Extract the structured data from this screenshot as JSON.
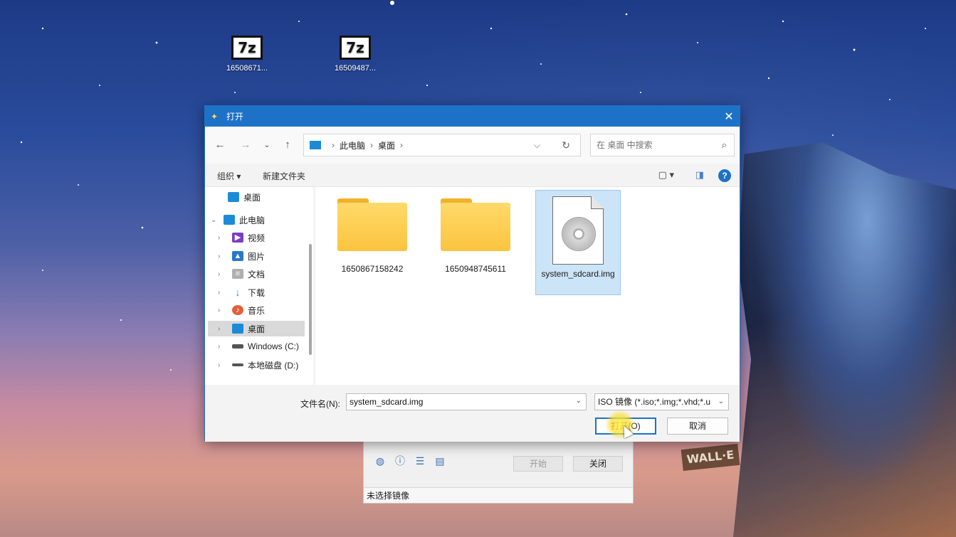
{
  "desktop": {
    "icons": [
      {
        "tile": "7z",
        "label": "16508671..."
      },
      {
        "tile": "7z",
        "label": "16509487..."
      }
    ],
    "wallpaper_badge": "WALL·E"
  },
  "background_app": {
    "start_label": "开始",
    "close_label": "关闭",
    "status": "未选择镜像"
  },
  "dialog": {
    "title": "打开",
    "breadcrumb": [
      "此电脑",
      "桌面"
    ],
    "search_placeholder": "在 桌面 中搜索",
    "toolbar": {
      "organize": "组织 ▾",
      "new_folder": "新建文件夹"
    },
    "sidebar": [
      {
        "label": "桌面",
        "icon": "desktop-icon",
        "color": "#1b8bd6"
      },
      {
        "label": "此电脑",
        "icon": "computer-icon",
        "color": "#1b8bd6"
      },
      {
        "label": "视频",
        "icon": "video-icon",
        "color": "#7a3fbf"
      },
      {
        "label": "图片",
        "icon": "image-icon",
        "color": "#2a78c6"
      },
      {
        "label": "文档",
        "icon": "document-icon",
        "color": "#8a8a8a"
      },
      {
        "label": "下载",
        "icon": "download-icon",
        "color": "#1b8bd6"
      },
      {
        "label": "音乐",
        "icon": "music-icon",
        "color": "#e0603a"
      },
      {
        "label": "桌面",
        "icon": "desktop-icon",
        "color": "#1b8bd6"
      },
      {
        "label": "Windows (C:)",
        "icon": "drive-icon",
        "color": "#555555"
      },
      {
        "label": "本地磁盘 (D:)",
        "icon": "drive-icon",
        "color": "#555555"
      }
    ],
    "files": [
      {
        "name": "1650867158242",
        "type": "folder"
      },
      {
        "name": "1650948745611",
        "type": "folder"
      },
      {
        "name": "system_sdcard.img",
        "type": "disc-image"
      }
    ],
    "filename_label": "文件名(N):",
    "filename_value": "system_sdcard.img",
    "filetype_value": "ISO 镜像 (*.iso;*.img;*.vhd;*.u",
    "open_label": "打开(O)",
    "cancel_label": "取消",
    "accent": "#1d72c7"
  }
}
